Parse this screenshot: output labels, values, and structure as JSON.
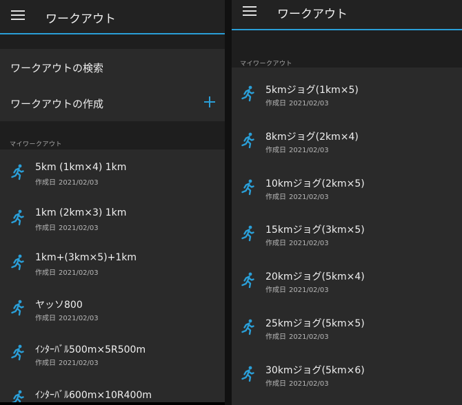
{
  "left": {
    "appbar": {
      "title": "ワークアウト"
    },
    "actions": {
      "search": "ワークアウトの検索",
      "create": "ワークアウトの作成"
    },
    "section_label": "マイワークアウト",
    "items": [
      {
        "name": "5km (1km×4) 1km",
        "date_label": "作成日",
        "date": "2021/02/03"
      },
      {
        "name": "1km (2km×3) 1km",
        "date_label": "作成日",
        "date": "2021/02/03"
      },
      {
        "name": "1km+(3km×5)+1km",
        "date_label": "作成日",
        "date": "2021/02/03"
      },
      {
        "name": "ヤッソ800",
        "date_label": "作成日",
        "date": "2021/02/03"
      },
      {
        "name": "ｲﾝﾀｰﾊﾞﾙ500m×5R500m",
        "date_label": "作成日",
        "date": "2021/02/03"
      },
      {
        "name": "ｲﾝﾀｰﾊﾞﾙ600m×10R400m",
        "date_label": "",
        "date": ""
      }
    ]
  },
  "right": {
    "appbar": {
      "title": "ワークアウト"
    },
    "section_label": "マイワークアウト",
    "items": [
      {
        "name": "5kmジョグ(1km×5)",
        "date_label": "作成日",
        "date": "2021/02/03"
      },
      {
        "name": "8kmジョグ(2km×4)",
        "date_label": "作成日",
        "date": "2021/02/03"
      },
      {
        "name": "10kmジョグ(2km×5)",
        "date_label": "作成日",
        "date": "2021/02/03"
      },
      {
        "name": "15kmジョグ(3km×5)",
        "date_label": "作成日",
        "date": "2021/02/03"
      },
      {
        "name": "20kmジョグ(5km×4)",
        "date_label": "作成日",
        "date": "2021/02/03"
      },
      {
        "name": "25kmジョグ(5km×5)",
        "date_label": "作成日",
        "date": "2021/02/03"
      },
      {
        "name": "30kmジョグ(5km×6)",
        "date_label": "作成日",
        "date": "2021/02/03"
      }
    ]
  },
  "colors": {
    "accent": "#2a9fd8",
    "background": "#2a2a2a",
    "appbar": "#222222"
  },
  "icons": {
    "menu": "hamburger-icon",
    "add": "plus-icon",
    "workout": "runner-icon"
  }
}
